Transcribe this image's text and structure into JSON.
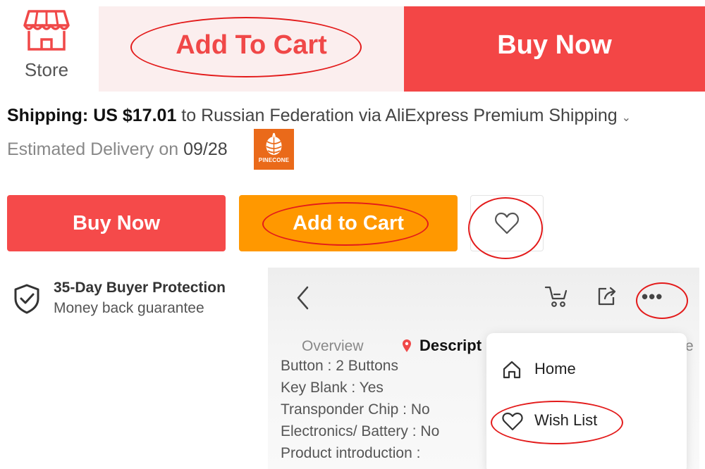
{
  "top_bar": {
    "store_label": "Store",
    "add_to_cart_label": "Add To Cart",
    "buy_now_label": "Buy Now"
  },
  "shipping": {
    "label": "Shipping:",
    "price": "US $17.01",
    "destination_text": "to Russian Federation via AliExpress Premium Shipping",
    "delivery_prefix": "Estimated Delivery on",
    "delivery_date": "09/28",
    "badge_text": "PINECONE"
  },
  "actions": {
    "buy_now_label": "Buy Now",
    "add_to_cart_label": "Add to Cart"
  },
  "protection": {
    "title": "35-Day Buyer Protection",
    "subtitle": "Money back guarantee"
  },
  "mobile": {
    "tabs": {
      "overview": "Overview",
      "description": "Descript",
      "tail": "e"
    },
    "spec_lines": [
      "Button : 2 Buttons",
      "Key Blank : Yes",
      "Transponder Chip : No",
      "Electronics/ Battery : No",
      "Product introduction :"
    ],
    "menu": {
      "home_label": "Home",
      "wish_list_label": "Wish List"
    }
  },
  "colors": {
    "red": "#f34646",
    "orange": "#ff9800",
    "annotation": "#e31b1b",
    "badge": "#ea6a1a"
  },
  "icons": {
    "store": "store-icon",
    "heart": "heart-icon",
    "shield": "shield-check-icon",
    "back": "chevron-left-icon",
    "cart": "cart-icon",
    "share": "share-icon",
    "more": "more-icon",
    "location": "location-pin-icon",
    "home": "home-icon"
  }
}
